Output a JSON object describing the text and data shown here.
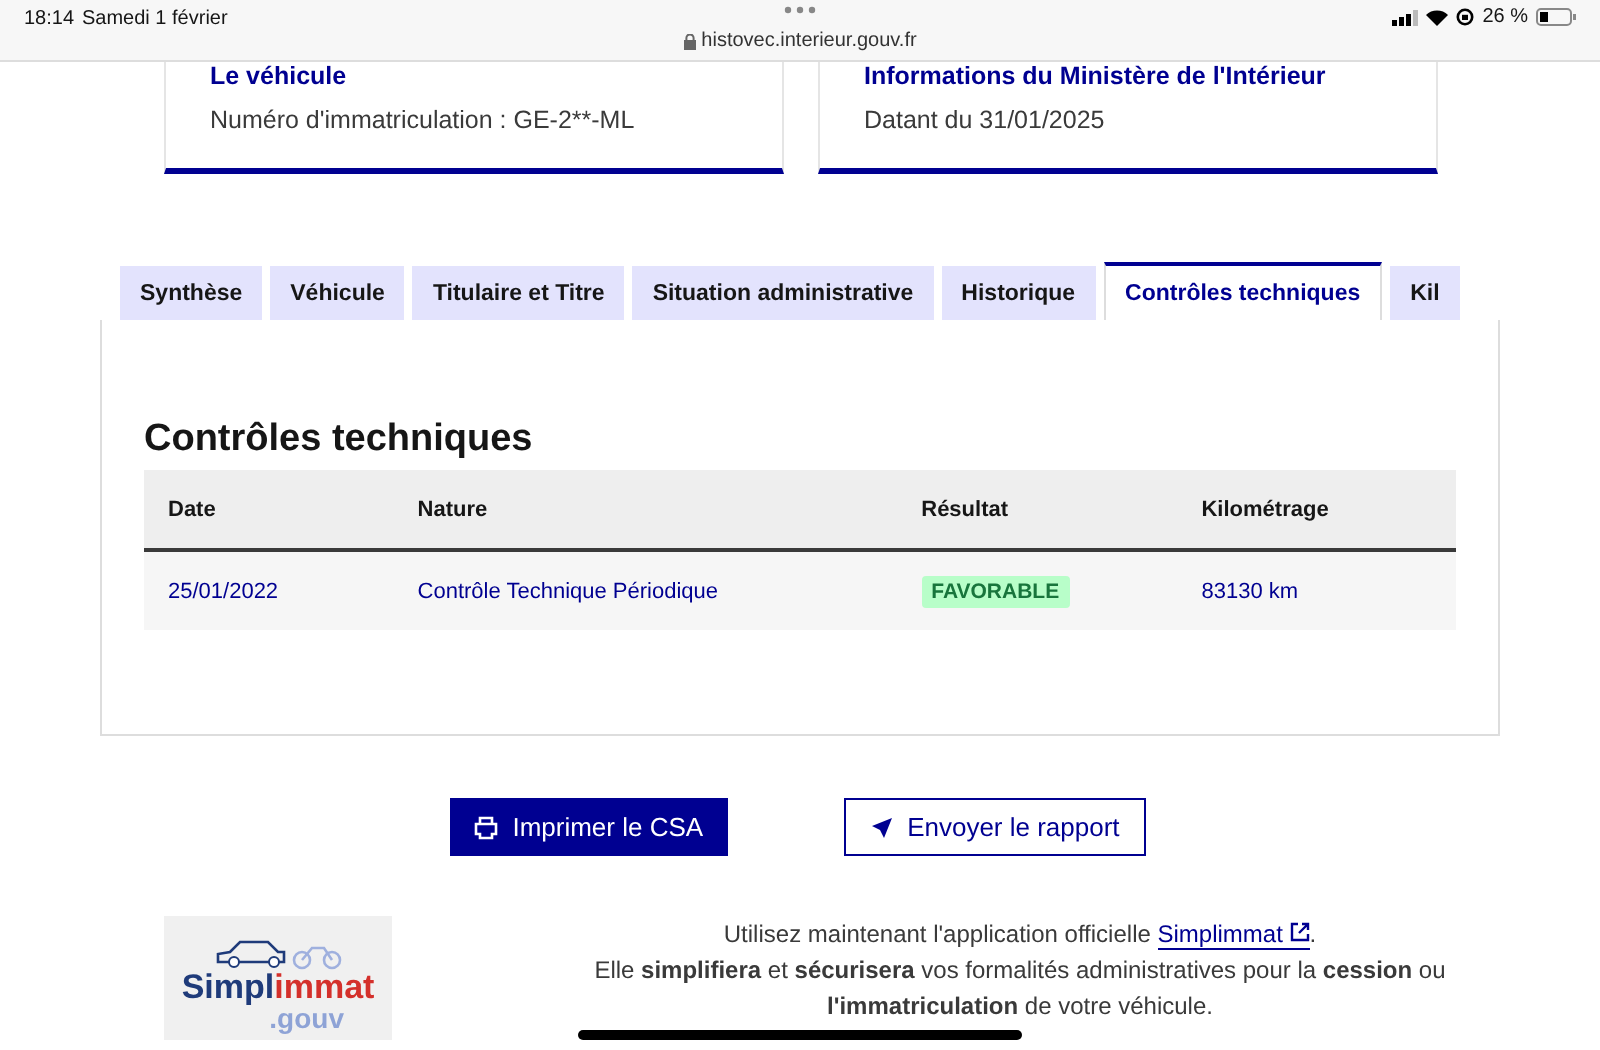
{
  "status_bar": {
    "time": "18:14",
    "date": "Samedi 1 février",
    "url": "histovec.interieur.gouv.fr",
    "battery": "26 %"
  },
  "cards": [
    {
      "title": "Le véhicule",
      "text": "Numéro d'immatriculation : GE-2**-ML"
    },
    {
      "title": "Informations du Ministère de l'Intérieur",
      "text": "Datant du 31/01/2025"
    }
  ],
  "tabs": [
    {
      "label": "Synthèse",
      "selected": false
    },
    {
      "label": "Véhicule",
      "selected": false
    },
    {
      "label": "Titulaire et Titre",
      "selected": false
    },
    {
      "label": "Situation administrative",
      "selected": false
    },
    {
      "label": "Historique",
      "selected": false
    },
    {
      "label": "Contrôles techniques",
      "selected": true
    },
    {
      "label": "Kil",
      "selected": false
    }
  ],
  "section": {
    "title": "Contrôles techniques",
    "table": {
      "columns": [
        "Date",
        "Nature",
        "Résultat",
        "Kilométrage"
      ],
      "rows": [
        {
          "date": "25/01/2022",
          "nature": "Contrôle Technique Périodique",
          "result": "FAVORABLE",
          "mileage": "83130 km"
        }
      ]
    }
  },
  "buttons": [
    {
      "kind": "primary",
      "label": "Imprimer le CSA"
    },
    {
      "kind": "secondary",
      "label": "Envoyer le rapport"
    }
  ],
  "footer": {
    "logo": {
      "name_parts": [
        "Simpl",
        "immat"
      ],
      "suffix": ".gouv"
    },
    "line_1": {
      "before": "Utilisez maintenant l'application officielle ",
      "link": "Simplimmat",
      "after": "."
    },
    "line_2": "Elle **simplifiera** et **sécurisera** vos formalités administratives pour la **cession** ou **l'immatriculation** de votre véhicule."
  }
}
